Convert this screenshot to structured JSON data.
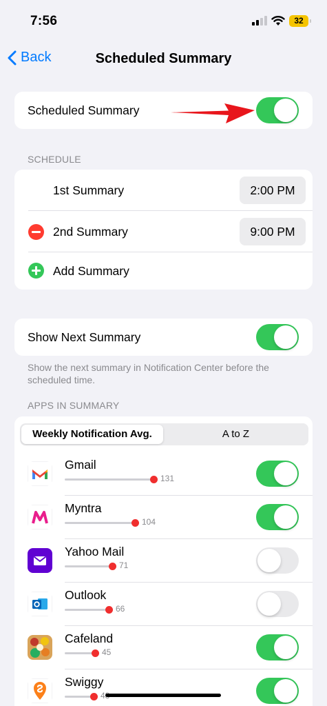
{
  "status_bar": {
    "time": "7:56",
    "battery": "32"
  },
  "nav": {
    "back_label": "Back",
    "title": "Scheduled Summary"
  },
  "scheduled_summary": {
    "label": "Scheduled Summary",
    "enabled": true
  },
  "schedule": {
    "header": "SCHEDULE",
    "items": [
      {
        "label": "1st Summary",
        "time": "2:00 PM"
      },
      {
        "label": "2nd Summary",
        "time": "9:00 PM"
      }
    ],
    "add_label": "Add Summary"
  },
  "next_summary": {
    "label": "Show Next Summary",
    "enabled": true,
    "footer": "Show the next summary in Notification Center before the scheduled time."
  },
  "apps": {
    "header": "APPS IN SUMMARY",
    "segments": [
      "Weekly Notification Avg.",
      "A to Z"
    ],
    "selected_segment": "Weekly Notification Avg.",
    "items": [
      {
        "name": "Gmail",
        "count": "131",
        "enabled": true,
        "icon": "gmail-icon"
      },
      {
        "name": "Myntra",
        "count": "104",
        "enabled": true,
        "icon": "myntra-icon"
      },
      {
        "name": "Yahoo Mail",
        "count": "71",
        "enabled": false,
        "icon": "yahoo-mail-icon"
      },
      {
        "name": "Outlook",
        "count": "66",
        "enabled": false,
        "icon": "outlook-icon"
      },
      {
        "name": "Cafeland",
        "count": "45",
        "enabled": true,
        "icon": "cafeland-icon"
      },
      {
        "name": "Swiggy",
        "count": "43",
        "enabled": true,
        "icon": "swiggy-icon"
      }
    ]
  },
  "colors": {
    "accent": "#007aff",
    "toggle_on": "#34c759",
    "bar_dot": "#f02e2e",
    "arrow": "#e8161c"
  }
}
